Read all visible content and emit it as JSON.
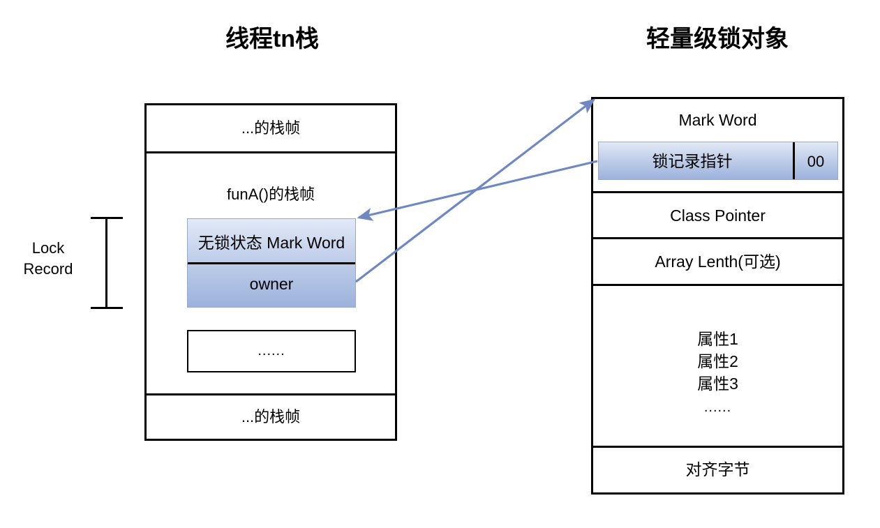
{
  "titles": {
    "left": "线程tn栈",
    "right": "轻量级锁对象"
  },
  "thread_stack": {
    "frames": [
      {
        "label": "...的栈帧"
      },
      {
        "label": "funA()的栈帧"
      },
      {
        "label": "...的栈帧"
      }
    ],
    "top_frame_label": "...的栈帧",
    "middle_frame_label": "funA()的栈帧",
    "bottom_frame_label": "...的栈帧",
    "ellipsis_box_label": "......",
    "lock_record": {
      "bracket_label_line1": "Lock",
      "bracket_label_line2": "Record",
      "rows": [
        {
          "label": "无锁状态 Mark Word"
        },
        {
          "label": "owner"
        }
      ],
      "mark_word_label": "无锁状态 Mark Word",
      "owner_label": "owner"
    }
  },
  "lock_object": {
    "rows": [
      {
        "label": "Mark Word"
      },
      {
        "label": "Class Pointer"
      },
      {
        "label": "Array Lenth(可选)"
      },
      {
        "label": "属性1\n属性2\n属性3\n......"
      },
      {
        "label": "对齐字节"
      }
    ],
    "mark_word_label": "Mark Word",
    "class_pointer_label": "Class Pointer",
    "array_length_label": "Array Lenth(可选)",
    "attributes": [
      "属性1",
      "属性2",
      "属性3",
      "......"
    ],
    "padding_label": "对齐字节",
    "mark_word_detail": {
      "pointer_label": "锁记录指针",
      "tag_bits": "00"
    }
  },
  "colors": {
    "stroke": "#000000",
    "arrow": "#6f88c1",
    "blue_fill_top": "#e2e9f7",
    "blue_fill_bottom": "#9db2dc",
    "blue_border": "#95a9cd",
    "background": "#ffffff"
  }
}
